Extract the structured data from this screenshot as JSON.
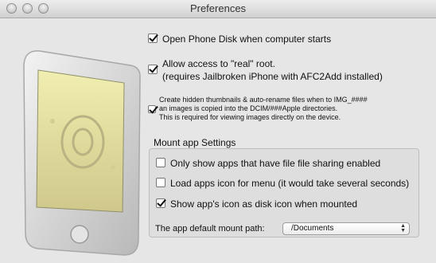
{
  "window": {
    "title": "Preferences"
  },
  "general": {
    "open_disk": {
      "label": "Open Phone Disk when computer starts",
      "checked": true
    },
    "root_access": {
      "line1": "Allow access to \"real\" root.",
      "line2": "(requires Jailbroken iPhone with AFC2Add installed)",
      "checked": true
    },
    "thumbnails": {
      "line1": "Create hidden thumbnails & auto-rename files when to IMG_####",
      "line2": "an images is copied into the DCIM/###Apple directories.",
      "line3": "This is required for viewing images directly on the device.",
      "checked": true
    }
  },
  "mount": {
    "group_title": "Mount app Settings",
    "only_sharing": {
      "label": "Only show apps that have file file sharing enabled",
      "checked": false
    },
    "load_icons": {
      "label": "Load apps icon for menu  (it would take several seconds)",
      "checked": false
    },
    "show_icon": {
      "label": "Show app's icon as disk icon when mounted",
      "checked": true
    },
    "path_label": "The app default mount path:",
    "path_value": "/Documents"
  },
  "colors": {
    "accent": "#111111",
    "window_bg": "#e6e6e6"
  },
  "icons": [
    "close-button",
    "minimize-button",
    "zoom-button",
    "iphone-illustration"
  ]
}
